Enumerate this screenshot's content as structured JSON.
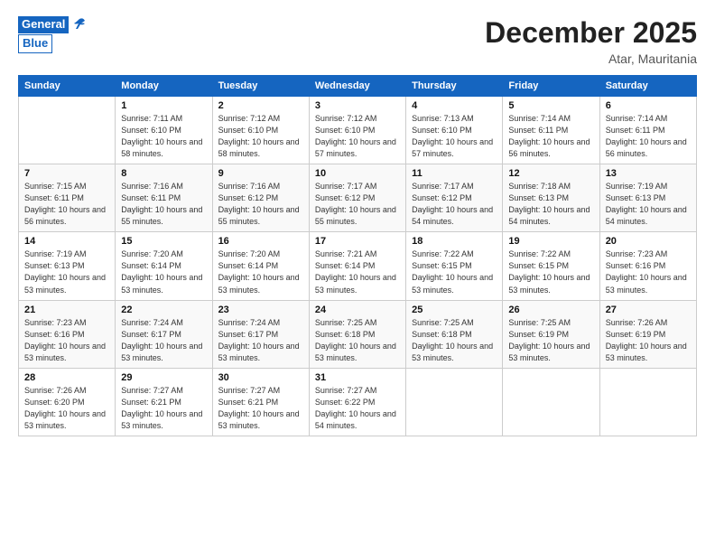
{
  "logo": {
    "line1": "General",
    "line2": "Blue"
  },
  "header": {
    "title": "December 2025",
    "location": "Atar, Mauritania"
  },
  "columns": [
    "Sunday",
    "Monday",
    "Tuesday",
    "Wednesday",
    "Thursday",
    "Friday",
    "Saturday"
  ],
  "weeks": [
    [
      {
        "day": "",
        "sunrise": "",
        "sunset": "",
        "daylight": ""
      },
      {
        "day": "1",
        "sunrise": "Sunrise: 7:11 AM",
        "sunset": "Sunset: 6:10 PM",
        "daylight": "Daylight: 10 hours and 58 minutes."
      },
      {
        "day": "2",
        "sunrise": "Sunrise: 7:12 AM",
        "sunset": "Sunset: 6:10 PM",
        "daylight": "Daylight: 10 hours and 58 minutes."
      },
      {
        "day": "3",
        "sunrise": "Sunrise: 7:12 AM",
        "sunset": "Sunset: 6:10 PM",
        "daylight": "Daylight: 10 hours and 57 minutes."
      },
      {
        "day": "4",
        "sunrise": "Sunrise: 7:13 AM",
        "sunset": "Sunset: 6:10 PM",
        "daylight": "Daylight: 10 hours and 57 minutes."
      },
      {
        "day": "5",
        "sunrise": "Sunrise: 7:14 AM",
        "sunset": "Sunset: 6:11 PM",
        "daylight": "Daylight: 10 hours and 56 minutes."
      },
      {
        "day": "6",
        "sunrise": "Sunrise: 7:14 AM",
        "sunset": "Sunset: 6:11 PM",
        "daylight": "Daylight: 10 hours and 56 minutes."
      }
    ],
    [
      {
        "day": "7",
        "sunrise": "Sunrise: 7:15 AM",
        "sunset": "Sunset: 6:11 PM",
        "daylight": "Daylight: 10 hours and 56 minutes."
      },
      {
        "day": "8",
        "sunrise": "Sunrise: 7:16 AM",
        "sunset": "Sunset: 6:11 PM",
        "daylight": "Daylight: 10 hours and 55 minutes."
      },
      {
        "day": "9",
        "sunrise": "Sunrise: 7:16 AM",
        "sunset": "Sunset: 6:12 PM",
        "daylight": "Daylight: 10 hours and 55 minutes."
      },
      {
        "day": "10",
        "sunrise": "Sunrise: 7:17 AM",
        "sunset": "Sunset: 6:12 PM",
        "daylight": "Daylight: 10 hours and 55 minutes."
      },
      {
        "day": "11",
        "sunrise": "Sunrise: 7:17 AM",
        "sunset": "Sunset: 6:12 PM",
        "daylight": "Daylight: 10 hours and 54 minutes."
      },
      {
        "day": "12",
        "sunrise": "Sunrise: 7:18 AM",
        "sunset": "Sunset: 6:13 PM",
        "daylight": "Daylight: 10 hours and 54 minutes."
      },
      {
        "day": "13",
        "sunrise": "Sunrise: 7:19 AM",
        "sunset": "Sunset: 6:13 PM",
        "daylight": "Daylight: 10 hours and 54 minutes."
      }
    ],
    [
      {
        "day": "14",
        "sunrise": "Sunrise: 7:19 AM",
        "sunset": "Sunset: 6:13 PM",
        "daylight": "Daylight: 10 hours and 53 minutes."
      },
      {
        "day": "15",
        "sunrise": "Sunrise: 7:20 AM",
        "sunset": "Sunset: 6:14 PM",
        "daylight": "Daylight: 10 hours and 53 minutes."
      },
      {
        "day": "16",
        "sunrise": "Sunrise: 7:20 AM",
        "sunset": "Sunset: 6:14 PM",
        "daylight": "Daylight: 10 hours and 53 minutes."
      },
      {
        "day": "17",
        "sunrise": "Sunrise: 7:21 AM",
        "sunset": "Sunset: 6:14 PM",
        "daylight": "Daylight: 10 hours and 53 minutes."
      },
      {
        "day": "18",
        "sunrise": "Sunrise: 7:22 AM",
        "sunset": "Sunset: 6:15 PM",
        "daylight": "Daylight: 10 hours and 53 minutes."
      },
      {
        "day": "19",
        "sunrise": "Sunrise: 7:22 AM",
        "sunset": "Sunset: 6:15 PM",
        "daylight": "Daylight: 10 hours and 53 minutes."
      },
      {
        "day": "20",
        "sunrise": "Sunrise: 7:23 AM",
        "sunset": "Sunset: 6:16 PM",
        "daylight": "Daylight: 10 hours and 53 minutes."
      }
    ],
    [
      {
        "day": "21",
        "sunrise": "Sunrise: 7:23 AM",
        "sunset": "Sunset: 6:16 PM",
        "daylight": "Daylight: 10 hours and 53 minutes."
      },
      {
        "day": "22",
        "sunrise": "Sunrise: 7:24 AM",
        "sunset": "Sunset: 6:17 PM",
        "daylight": "Daylight: 10 hours and 53 minutes."
      },
      {
        "day": "23",
        "sunrise": "Sunrise: 7:24 AM",
        "sunset": "Sunset: 6:17 PM",
        "daylight": "Daylight: 10 hours and 53 minutes."
      },
      {
        "day": "24",
        "sunrise": "Sunrise: 7:25 AM",
        "sunset": "Sunset: 6:18 PM",
        "daylight": "Daylight: 10 hours and 53 minutes."
      },
      {
        "day": "25",
        "sunrise": "Sunrise: 7:25 AM",
        "sunset": "Sunset: 6:18 PM",
        "daylight": "Daylight: 10 hours and 53 minutes."
      },
      {
        "day": "26",
        "sunrise": "Sunrise: 7:25 AM",
        "sunset": "Sunset: 6:19 PM",
        "daylight": "Daylight: 10 hours and 53 minutes."
      },
      {
        "day": "27",
        "sunrise": "Sunrise: 7:26 AM",
        "sunset": "Sunset: 6:19 PM",
        "daylight": "Daylight: 10 hours and 53 minutes."
      }
    ],
    [
      {
        "day": "28",
        "sunrise": "Sunrise: 7:26 AM",
        "sunset": "Sunset: 6:20 PM",
        "daylight": "Daylight: 10 hours and 53 minutes."
      },
      {
        "day": "29",
        "sunrise": "Sunrise: 7:27 AM",
        "sunset": "Sunset: 6:21 PM",
        "daylight": "Daylight: 10 hours and 53 minutes."
      },
      {
        "day": "30",
        "sunrise": "Sunrise: 7:27 AM",
        "sunset": "Sunset: 6:21 PM",
        "daylight": "Daylight: 10 hours and 53 minutes."
      },
      {
        "day": "31",
        "sunrise": "Sunrise: 7:27 AM",
        "sunset": "Sunset: 6:22 PM",
        "daylight": "Daylight: 10 hours and 54 minutes."
      },
      {
        "day": "",
        "sunrise": "",
        "sunset": "",
        "daylight": ""
      },
      {
        "day": "",
        "sunrise": "",
        "sunset": "",
        "daylight": ""
      },
      {
        "day": "",
        "sunrise": "",
        "sunset": "",
        "daylight": ""
      }
    ]
  ]
}
